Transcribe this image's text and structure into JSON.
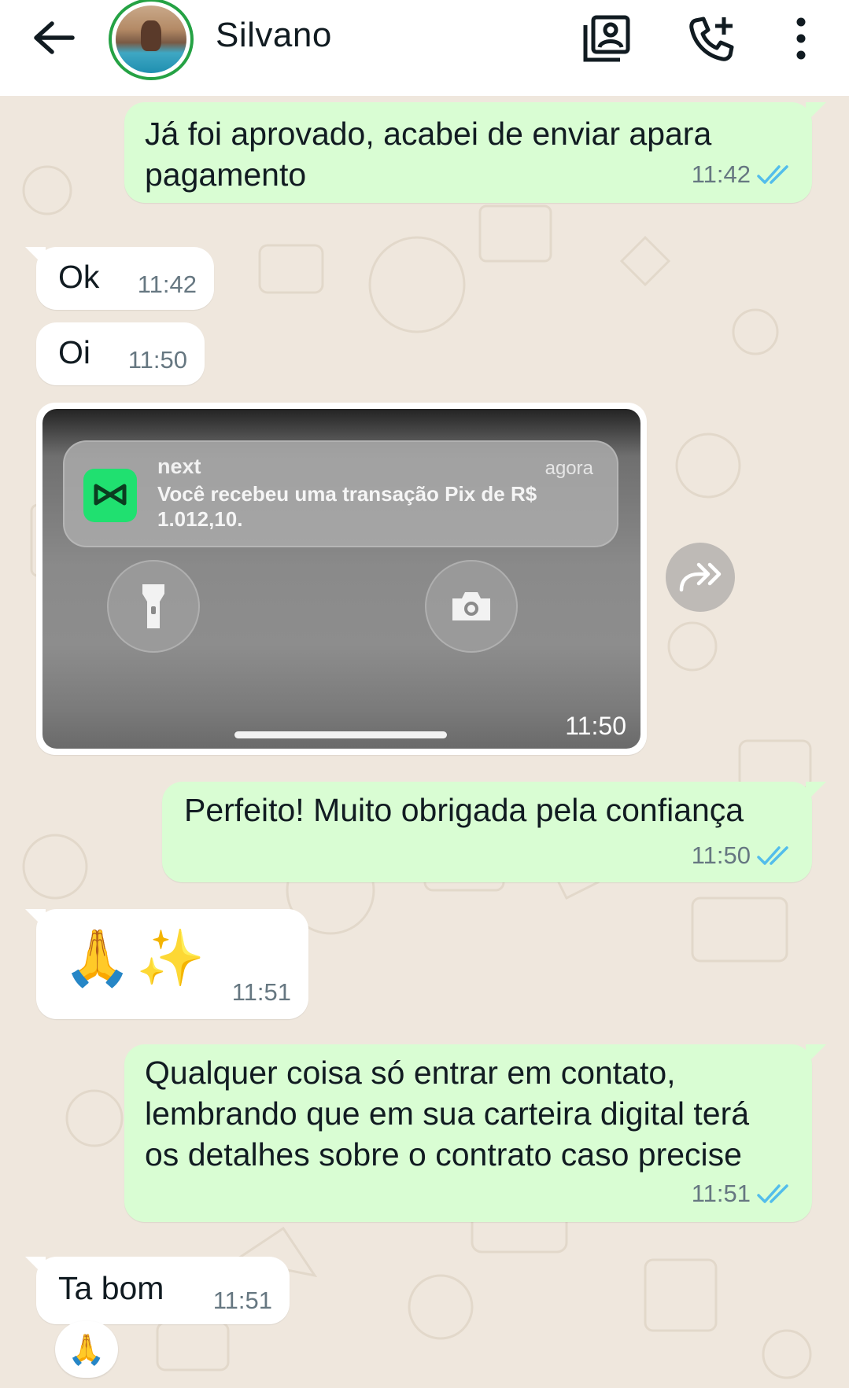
{
  "header": {
    "contact_name": "Silvano",
    "icons": [
      "back-arrow-icon",
      "avatar",
      "gallery-icon",
      "add-call-icon",
      "more-vert-icon"
    ]
  },
  "messages": [
    {
      "id": "m1",
      "direction": "out",
      "text": "Já foi aprovado, acabei de enviar apara pagamento",
      "time": "11:42",
      "status": "read"
    },
    {
      "id": "m2",
      "direction": "in",
      "text": "Ok",
      "time": "11:42"
    },
    {
      "id": "m3",
      "direction": "in",
      "text": "Oi",
      "time": "11:50"
    },
    {
      "id": "m4",
      "direction": "in",
      "type": "image",
      "time": "11:50",
      "image": {
        "notification_app": "next",
        "notification_time": "agora",
        "notification_body": "Você recebeu uma transação Pix de R$ 1.012,10."
      }
    },
    {
      "id": "m5",
      "direction": "out",
      "text": "Perfeito! Muito obrigada pela confiança",
      "time": "11:50",
      "status": "read"
    },
    {
      "id": "m6",
      "direction": "in",
      "text": "🙏✨",
      "time": "11:51"
    },
    {
      "id": "m7",
      "direction": "out",
      "text": "Qualquer coisa só entrar em contato, lembrando que em sua carteira digital terá os detalhes sobre o contrato caso precise",
      "time": "11:51",
      "status": "read"
    },
    {
      "id": "m8",
      "direction": "in",
      "text": "Ta bom",
      "time": "11:51",
      "reaction": "🙏"
    }
  ],
  "colors": {
    "outgoing_bubble": "#d9fdd3",
    "incoming_bubble": "#ffffff",
    "read_ticks": "#53bdeb",
    "chat_background": "#efe7dd",
    "avatar_ring": "#25a244"
  }
}
